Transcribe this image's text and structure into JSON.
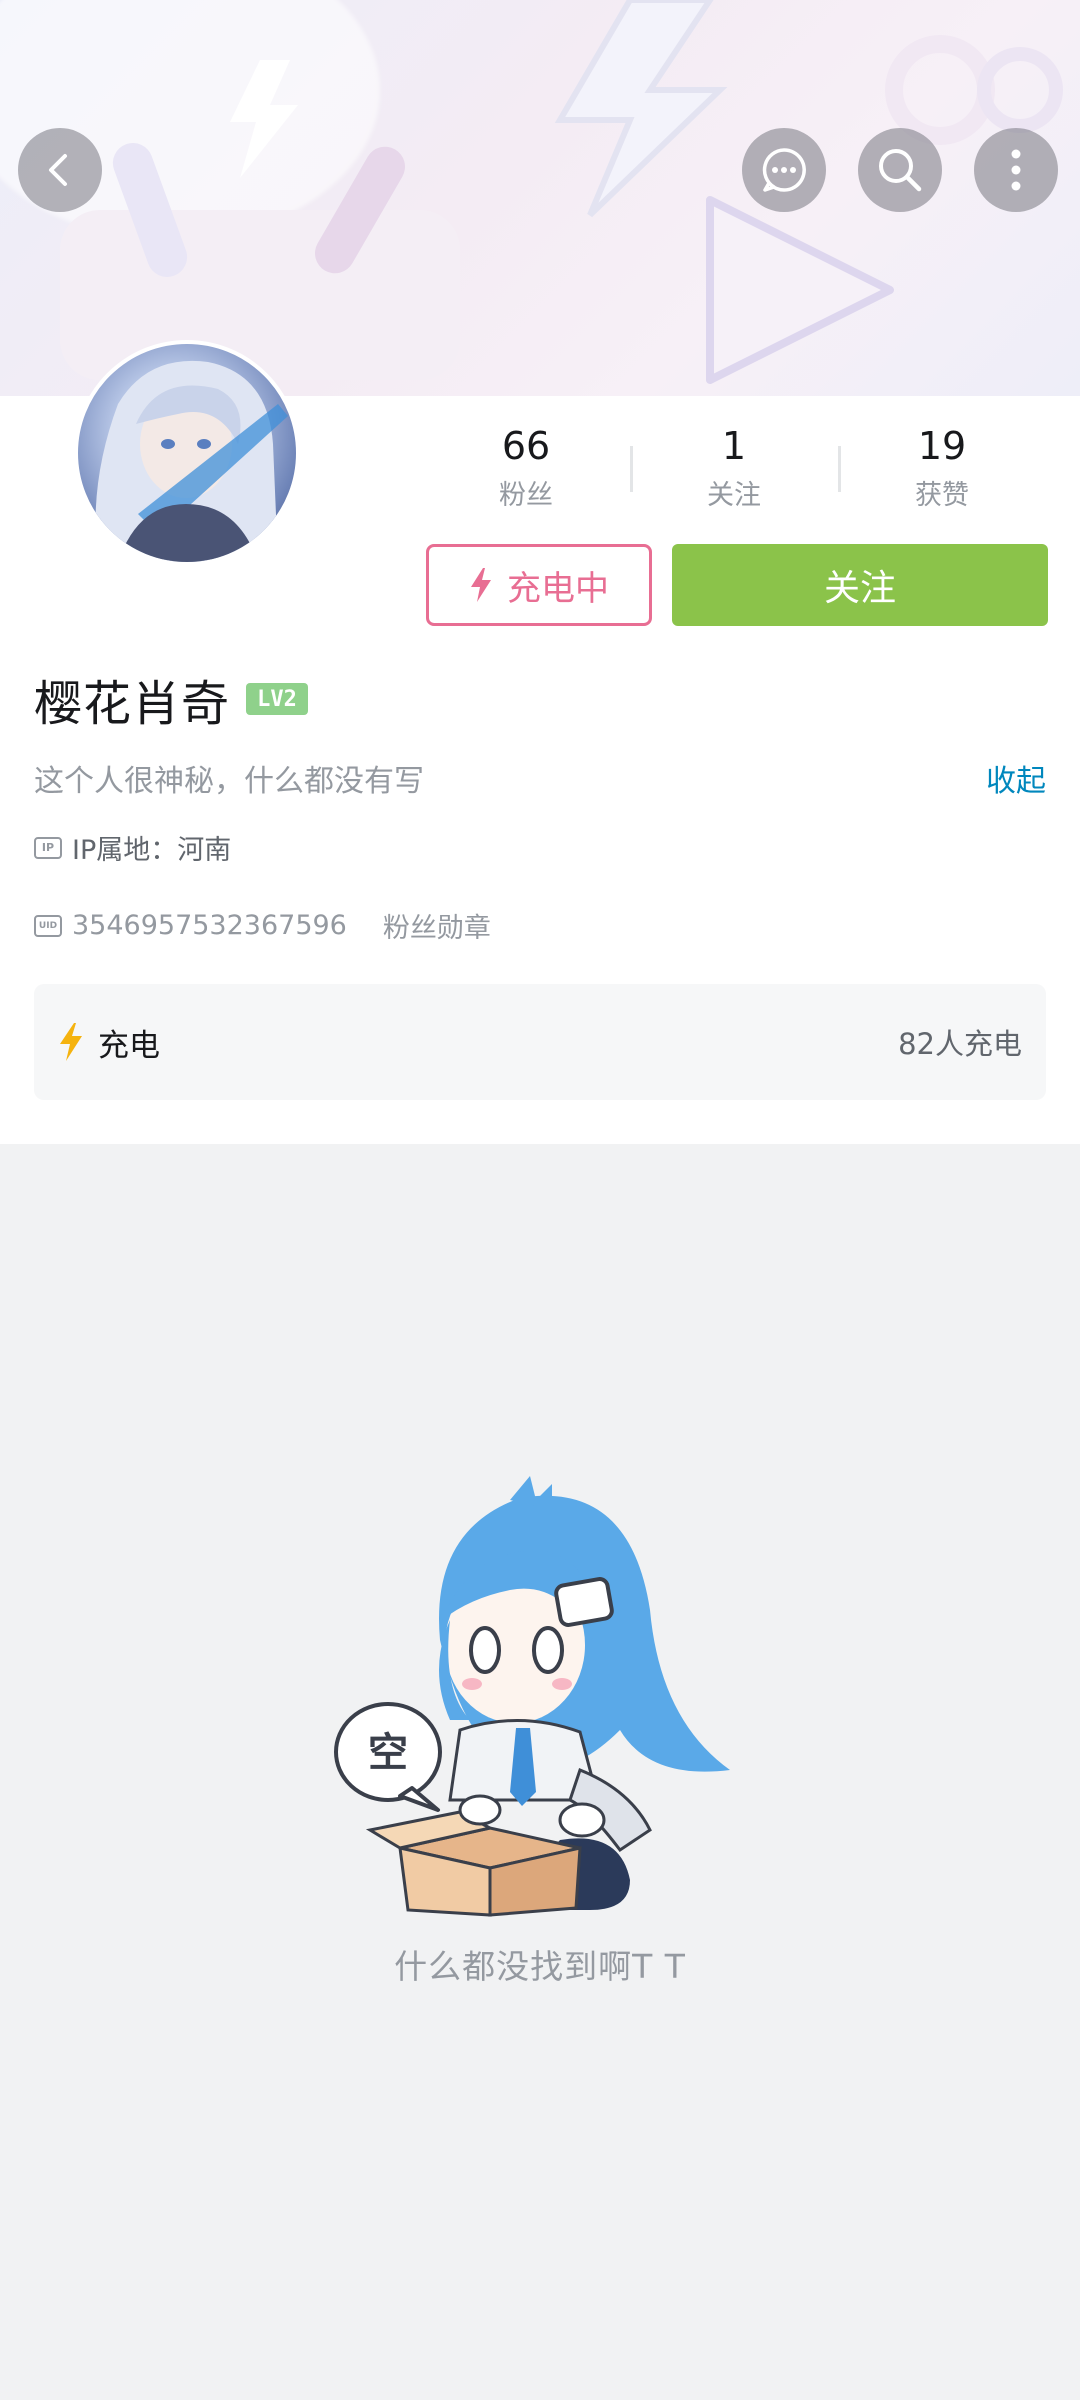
{
  "header": {
    "back_icon": "chevron-left-icon",
    "actions": [
      "message-icon",
      "search-icon",
      "more-vertical-icon"
    ]
  },
  "profile": {
    "stats": [
      {
        "value": "66",
        "label": "粉丝"
      },
      {
        "value": "1",
        "label": "关注"
      },
      {
        "value": "19",
        "label": "获赞"
      }
    ],
    "charging_label": "充电中",
    "follow_label": "关注",
    "name": "樱花肖奇",
    "level": "LV2",
    "bio": "这个人很神秘，什么都没有写",
    "collapse_label": "收起",
    "ip_badge": "IP",
    "ip_location": "IP属地：河南",
    "uid_badge": "UID",
    "uid": "3546957532367596",
    "fan_medal_label": "粉丝勋章"
  },
  "charge_panel": {
    "title": "充电",
    "count_text": "82人充电"
  },
  "empty_state": {
    "bubble_text": "空",
    "message": "什么都没找到啊T T"
  },
  "colors": {
    "accent_pink": "#e86e93",
    "follow_green": "#8bc34a",
    "link_blue": "#0087bd",
    "level_green": "#8fd18b",
    "bolt_yellow": "#f5b30f"
  }
}
